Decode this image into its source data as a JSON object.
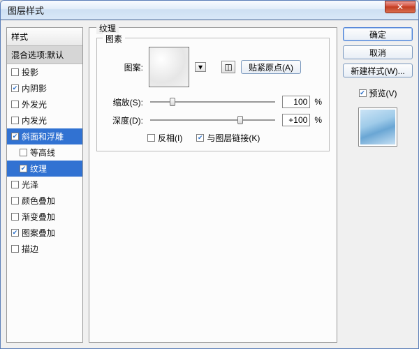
{
  "window": {
    "title": "图层样式"
  },
  "left": {
    "header": "样式",
    "selected_header": "混合选项:默认",
    "items": [
      {
        "label": "投影",
        "checked": false,
        "indent": false
      },
      {
        "label": "内阴影",
        "checked": true,
        "indent": false
      },
      {
        "label": "外发光",
        "checked": false,
        "indent": false
      },
      {
        "label": "内发光",
        "checked": false,
        "indent": false
      },
      {
        "label": "斜面和浮雕",
        "checked": true,
        "indent": false,
        "selected": true
      },
      {
        "label": "等高线",
        "checked": false,
        "indent": true
      },
      {
        "label": "纹理",
        "checked": true,
        "indent": true,
        "selected": true
      },
      {
        "label": "光泽",
        "checked": false,
        "indent": false
      },
      {
        "label": "颜色叠加",
        "checked": false,
        "indent": false
      },
      {
        "label": "渐变叠加",
        "checked": false,
        "indent": false
      },
      {
        "label": "图案叠加",
        "checked": true,
        "indent": false
      },
      {
        "label": "描边",
        "checked": false,
        "indent": false
      }
    ]
  },
  "mid": {
    "group": "纹理",
    "inner_group": "图素",
    "pattern_label": "图案:",
    "snap_btn": "贴紧原点(A)",
    "scale_label": "缩放(S):",
    "scale_value": "100",
    "depth_label": "深度(D):",
    "depth_value": "+100",
    "percent": "%",
    "invert_label": "反相(I)",
    "invert_checked": false,
    "link_label": "与图层链接(K)",
    "link_checked": true
  },
  "right": {
    "ok": "确定",
    "cancel": "取消",
    "new_style": "新建样式(W)...",
    "preview_label": "预览(V)",
    "preview_checked": true
  }
}
